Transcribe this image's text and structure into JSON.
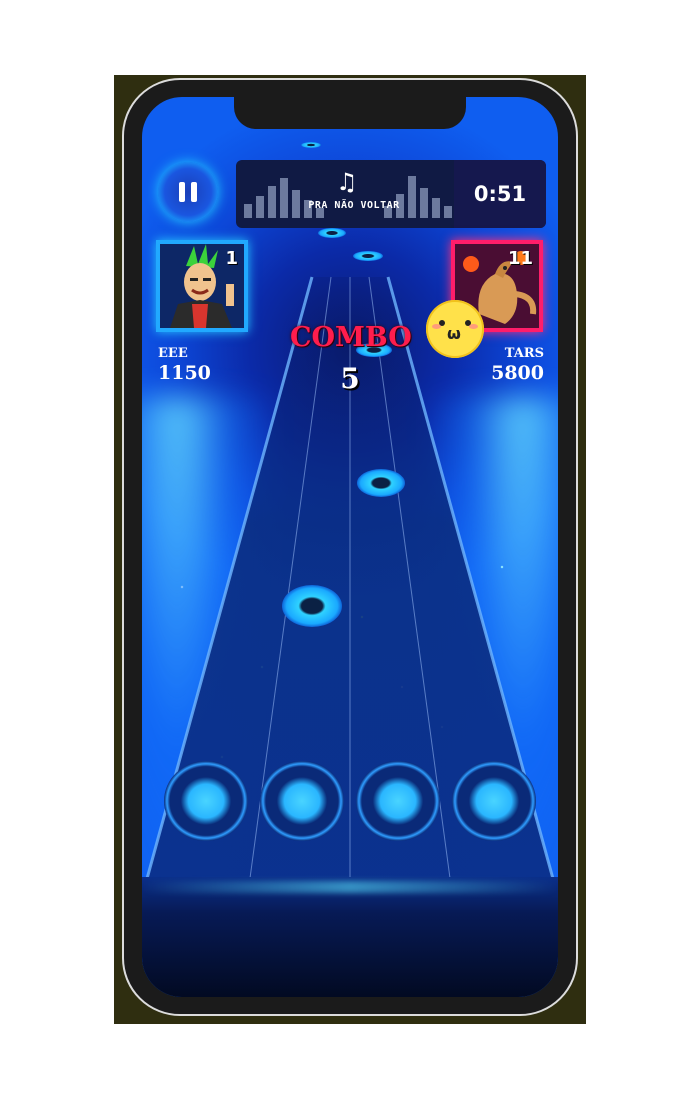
{
  "game": {
    "pause_icon": "pause-icon",
    "song": {
      "title": "PRA NÃO VOLTAR",
      "icon": "music-note-icon"
    },
    "timer": "0:51",
    "combo": {
      "label": "COMBO",
      "count": "5"
    },
    "reaction_emoji": "smiley-face-icon",
    "players": [
      {
        "name": "EEE",
        "score": "1150",
        "rank": "1",
        "color": "#21a9ff"
      },
      {
        "name": "TARS",
        "score": "5800",
        "rank": "11",
        "color": "#ff1d6a"
      }
    ],
    "lanes": 4,
    "accent": "#22c7ff"
  }
}
